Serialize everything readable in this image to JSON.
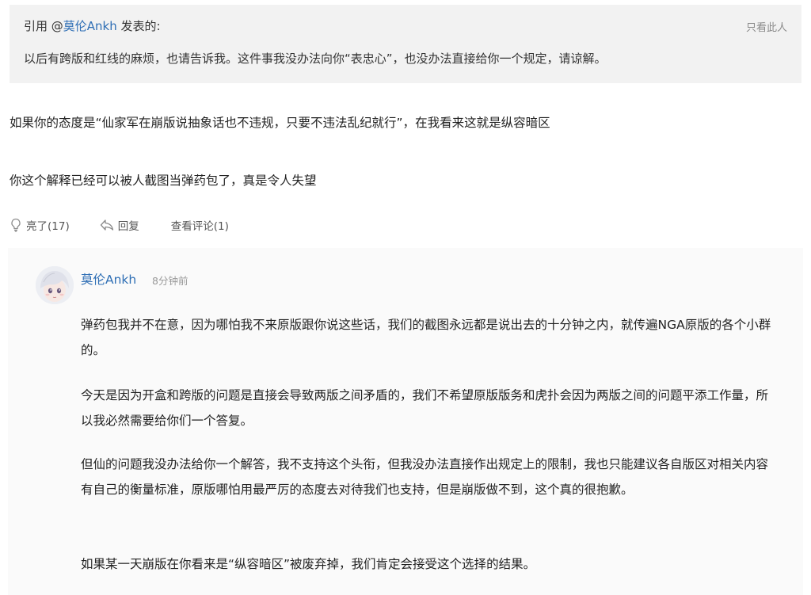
{
  "quote": {
    "prefix": "引用 @",
    "author": "莫伦Ankh",
    "suffix": " 发表的:",
    "only_this_label": "只看此人",
    "text": "以后有跨版和红线的麻烦，也请告诉我。这件事我没办法向你“表忠心”，也没办法直接给你一个规定，请谅解。"
  },
  "post": {
    "paragraphs": [
      "如果你的态度是“仙家军在崩版说抽象话也不违规，只要不违法乱纪就行”，在我看来这就是纵容暗区",
      "你这个解释已经可以被人截图当弹药包了，真是令人失望"
    ]
  },
  "actions": {
    "like_label": "亮了(17)",
    "reply_label": "回复",
    "comments_label": "查看评论(1)"
  },
  "reply": {
    "author": "莫伦Ankh",
    "time": "8分钟前",
    "paragraphs": [
      "弹药包我并不在意，因为哪怕我不来原版跟你说这些话，我们的截图永远都是说出去的十分钟之内，就传遍NGA原版的各个小群的。",
      "今天是因为开盒和跨版的问题是直接会导致两版之间矛盾的，我们不希望原版版务和虎扑会因为两版之间的问题平添工作量，所以我必然需要给你们一个答复。",
      "但仙的问题我没办法给你一个解答，我不支持这个头衔，但我没办法直接作出规定上的限制，我也只能建议各自版区对相关内容有自己的衡量标准，原版哪怕用最严厉的态度去对待我们也支持，但是崩版做不到，这个真的很抱歉。",
      "如果某一天崩版在你看来是“纵容暗区”被废弃掉，我们肯定会接受这个选择的结果。"
    ]
  }
}
